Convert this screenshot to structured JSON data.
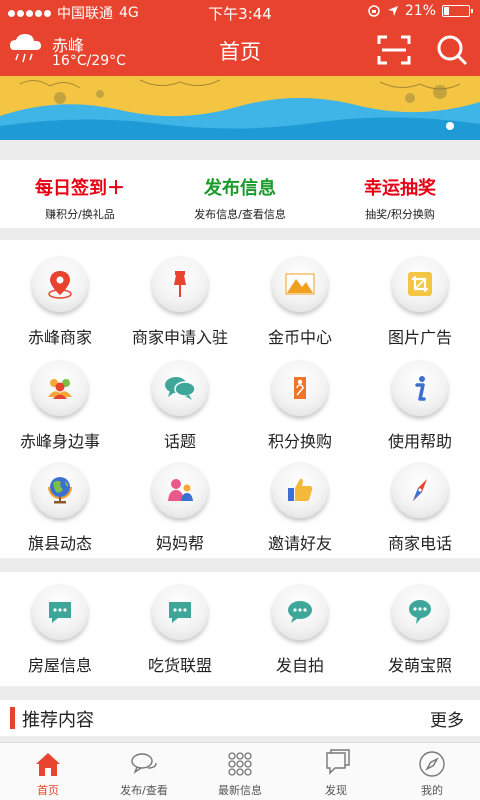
{
  "status": {
    "carrier": "中国联通",
    "network": "4G",
    "time": "下午3:44",
    "battery_text": "21%",
    "battery_level": 0.21
  },
  "nav": {
    "city": "赤峰",
    "temperature": "16°C/29°C",
    "title": "首页"
  },
  "quick_actions": [
    {
      "title": "每日签到＋",
      "subtitle": "赚积分/换礼品",
      "color": "#e60012"
    },
    {
      "title": "发布信息",
      "subtitle": "发布信息/查看信息",
      "color": "#1a9a2a"
    },
    {
      "title": "幸运抽奖",
      "subtitle": "抽奖/积分换购",
      "color": "#e60012"
    }
  ],
  "grid": [
    {
      "label": "赤峰商家",
      "icon": "location-pin-icon"
    },
    {
      "label": "商家申请入驻",
      "icon": "pushpin-icon"
    },
    {
      "label": "金币中心",
      "icon": "image-mountain-icon"
    },
    {
      "label": "图片广告",
      "icon": "crop-icon"
    },
    {
      "label": "赤峰身边事",
      "icon": "people-group-icon"
    },
    {
      "label": "话题",
      "icon": "chat-bubbles-icon"
    },
    {
      "label": "积分换购",
      "icon": "tag-icon"
    },
    {
      "label": "使用帮助",
      "icon": "info-icon"
    },
    {
      "label": "旗县动态",
      "icon": "globe-icon"
    },
    {
      "label": "妈妈帮",
      "icon": "mother-child-icon"
    },
    {
      "label": "邀请好友",
      "icon": "thumbs-up-icon"
    },
    {
      "label": "商家电话",
      "icon": "compass-icon"
    }
  ],
  "grid2": [
    {
      "label": "房屋信息",
      "icon": "message-icon"
    },
    {
      "label": "吃货联盟",
      "icon": "message-icon"
    },
    {
      "label": "发自拍",
      "icon": "message-icon"
    },
    {
      "label": "发萌宝照",
      "icon": "message-icon"
    }
  ],
  "recommended": {
    "title": "推荐内容",
    "more": "更多"
  },
  "tabs": [
    {
      "label": "首页",
      "icon": "home-icon",
      "active": true
    },
    {
      "label": "发布/查看",
      "icon": "chat-icon",
      "active": false
    },
    {
      "label": "最新信息",
      "icon": "grid-dots-icon",
      "active": false
    },
    {
      "label": "发现",
      "icon": "discover-icon",
      "active": false
    },
    {
      "label": "我的",
      "icon": "compass-icon",
      "active": false
    }
  ],
  "colors": {
    "accent": "#e8432e",
    "teal": "#3fa79a"
  }
}
